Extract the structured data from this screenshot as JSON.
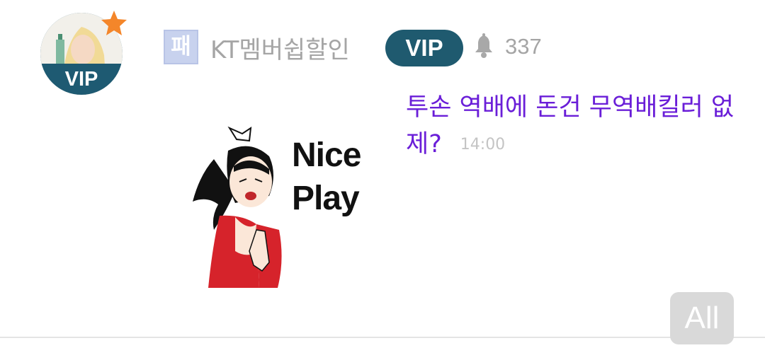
{
  "post": {
    "avatar": {
      "badge": "VIP"
    },
    "author": {
      "level_icon_text": "패",
      "nickname": "KT멤버쉽할인",
      "vip_pill": "VIP",
      "bell_count": "337"
    },
    "sticker": {
      "line1": "Nice",
      "line2": "Play"
    },
    "message": {
      "text": "투손 역배에 돈건 무역배킬러 없제?",
      "time": "14:00"
    }
  },
  "footer": {
    "all_button_label": "All"
  },
  "colors": {
    "message_text": "#6a1ed8",
    "vip_badge": "#1f5a6f",
    "star": "#f4862a",
    "muted_text": "#a5a5a5"
  },
  "icons": [
    "star-icon",
    "bell-icon"
  ]
}
